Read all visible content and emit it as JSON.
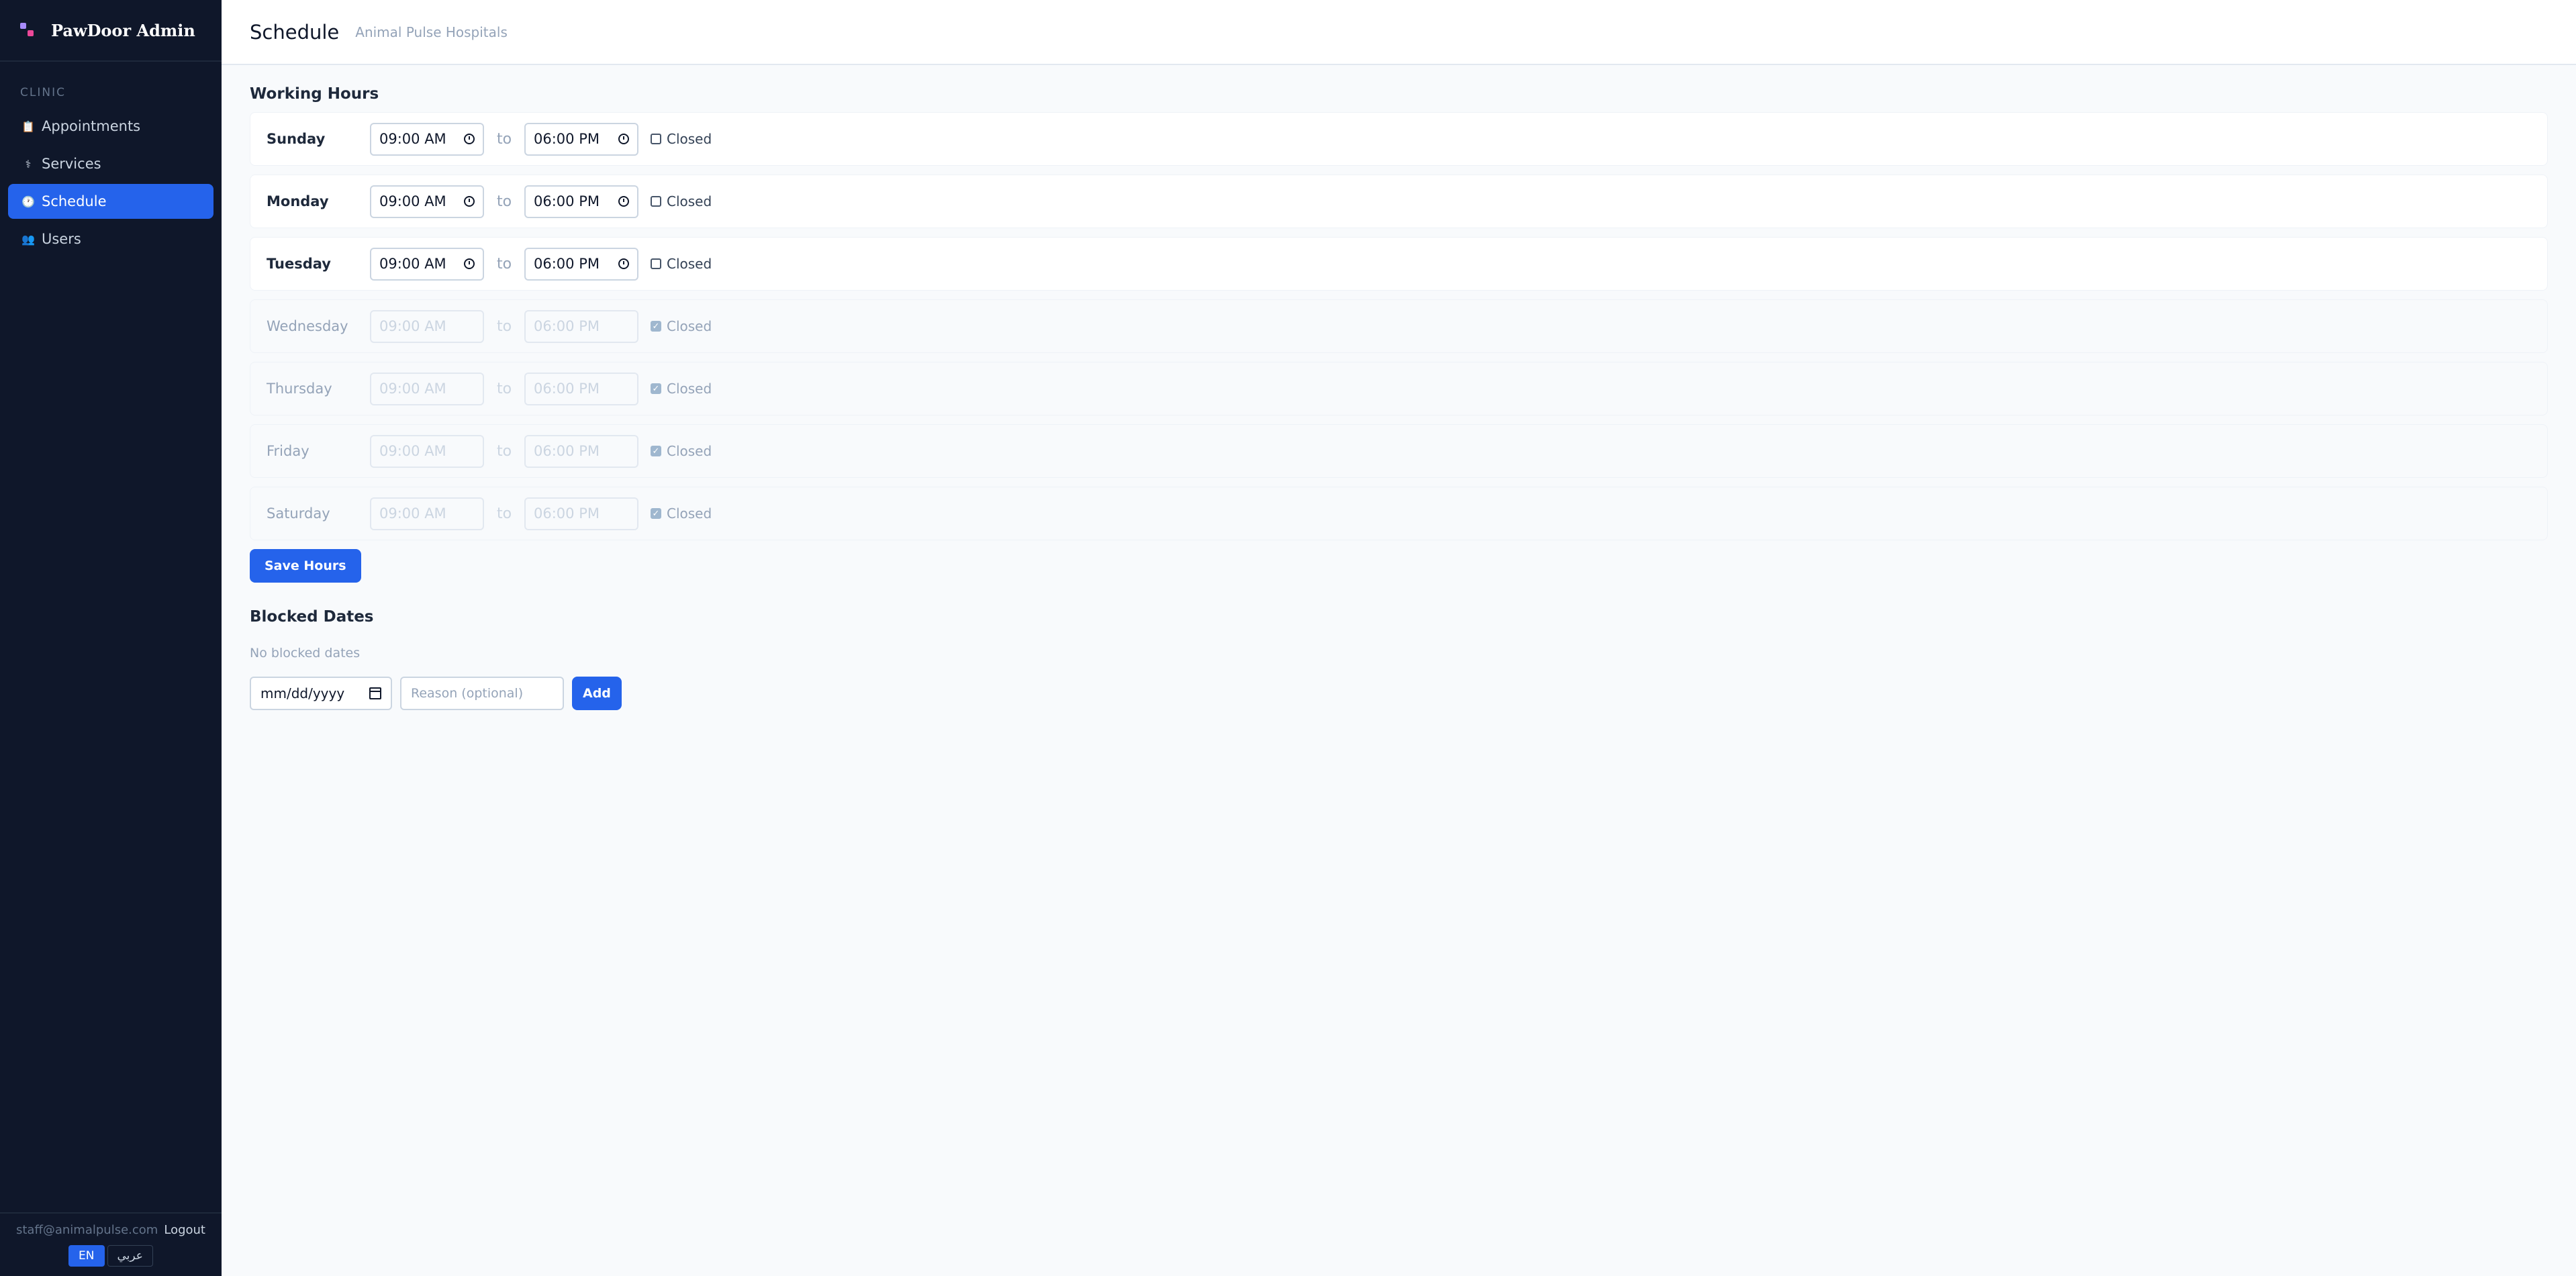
{
  "app": {
    "name": "PawDoor Admin"
  },
  "sidebar": {
    "section": "CLINIC",
    "items": [
      {
        "label": "Appointments",
        "icon": "clipboard-icon",
        "glyph": "📋",
        "active": false
      },
      {
        "label": "Services",
        "icon": "stethoscope-icon",
        "glyph": "⚕",
        "active": false
      },
      {
        "label": "Schedule",
        "icon": "clock-icon",
        "glyph": "🕐",
        "active": true
      },
      {
        "label": "Users",
        "icon": "users-icon",
        "glyph": "👥",
        "active": false
      }
    ],
    "footer": {
      "email": "staff@animalpulse.com",
      "logout": "Logout",
      "lang_en": "EN",
      "lang_ar": "عربي"
    }
  },
  "header": {
    "title": "Schedule",
    "subtitle": "Animal Pulse Hospitals"
  },
  "working_hours": {
    "title": "Working Hours",
    "to_label": "to",
    "closed_label": "Closed",
    "days": [
      {
        "name": "Sunday",
        "open": "09:00 AM",
        "close": "06:00 PM",
        "closed": false
      },
      {
        "name": "Monday",
        "open": "09:00 AM",
        "close": "06:00 PM",
        "closed": false
      },
      {
        "name": "Tuesday",
        "open": "09:00 AM",
        "close": "06:00 PM",
        "closed": false
      },
      {
        "name": "Wednesday",
        "open": "09:00 AM",
        "close": "06:00 PM",
        "closed": true
      },
      {
        "name": "Thursday",
        "open": "09:00 AM",
        "close": "06:00 PM",
        "closed": true
      },
      {
        "name": "Friday",
        "open": "09:00 AM",
        "close": "06:00 PM",
        "closed": true
      },
      {
        "name": "Saturday",
        "open": "09:00 AM",
        "close": "06:00 PM",
        "closed": true
      }
    ],
    "save_label": "Save Hours"
  },
  "blocked_dates": {
    "title": "Blocked Dates",
    "empty_text": "No blocked dates",
    "date_placeholder": "mm/dd/yyyy",
    "reason_placeholder": "Reason (optional)",
    "add_label": "Add"
  },
  "colors": {
    "sidebar_bg": "#0f172a",
    "accent": "#2563eb",
    "page_bg": "#f8fafc"
  }
}
